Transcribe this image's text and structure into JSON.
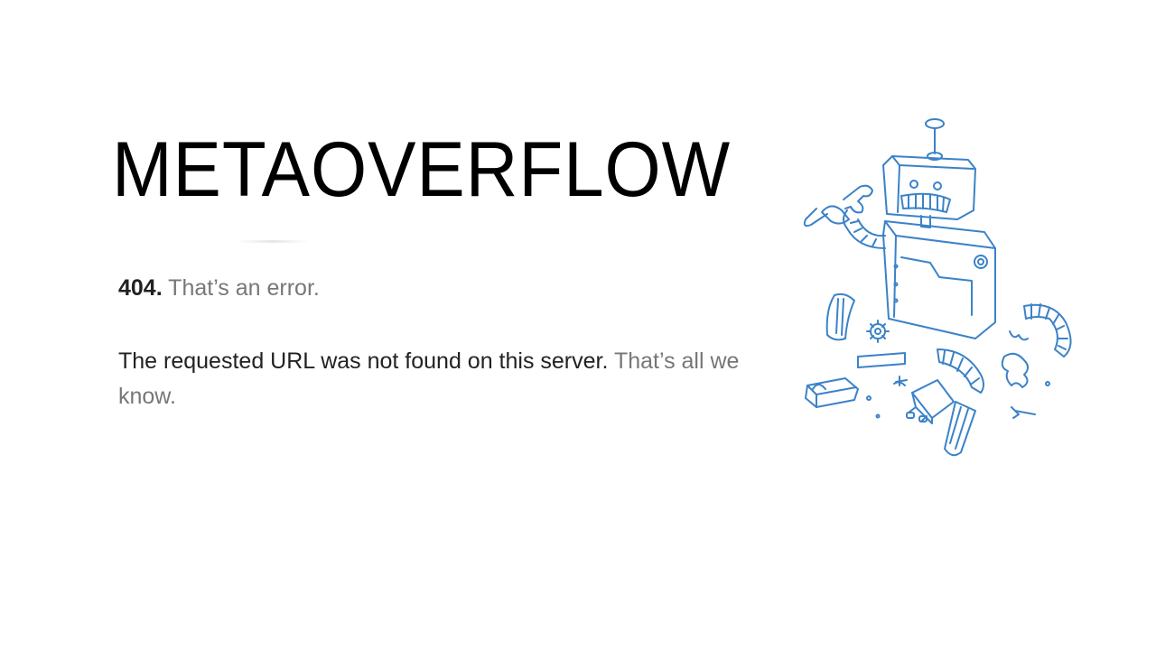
{
  "logo": {
    "text": "METAOVERFLOW"
  },
  "error": {
    "code": "404.",
    "title": "That’s an error.",
    "message": "The requested URL was not found on this server.",
    "message_muted": "That’s all we know."
  },
  "illustration": {
    "icon": "broken-robot-icon",
    "color": "#3b82c8"
  },
  "colors": {
    "background": "#ffffff",
    "text_dark": "#222222",
    "text_muted": "#777777"
  }
}
